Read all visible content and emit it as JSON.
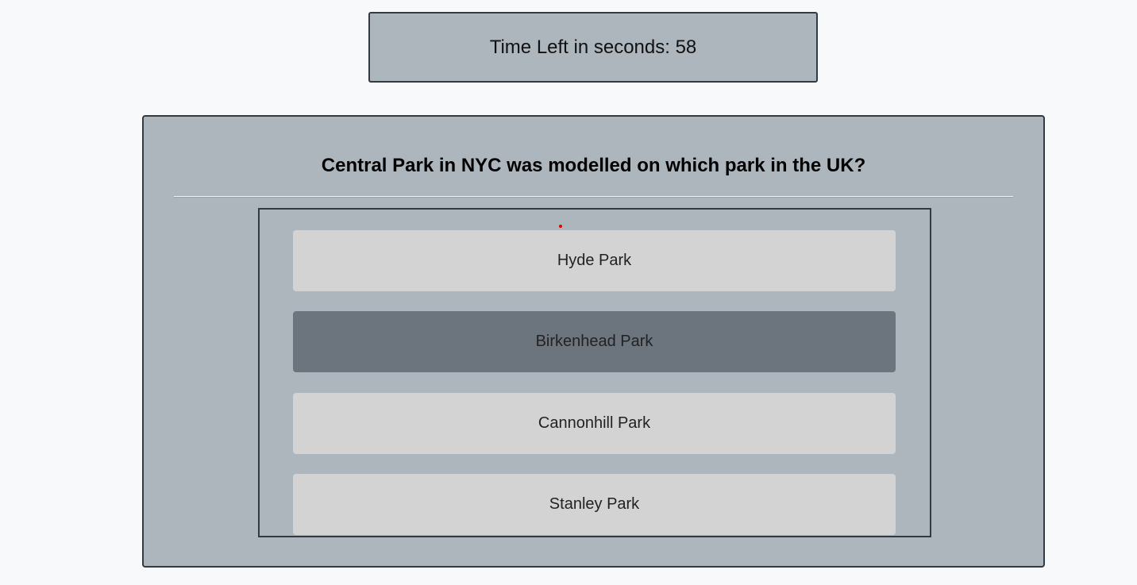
{
  "timer": {
    "label": "Time Left in seconds: 58"
  },
  "quiz": {
    "question": "Central Park in NYC was modelled on which park in the UK?",
    "answers": [
      {
        "label": "Hyde Park"
      },
      {
        "label": "Birkenhead Park"
      },
      {
        "label": "Cannonhill Park"
      },
      {
        "label": "Stanley Park"
      }
    ],
    "hovered_index": 1
  },
  "colors": {
    "page_background": "#f7f9fb",
    "panel": "#adb5bd",
    "border": "#343a40",
    "answer": "#d3d3d3",
    "answer_hover": "#6c757d",
    "cursor": "#e00000"
  }
}
